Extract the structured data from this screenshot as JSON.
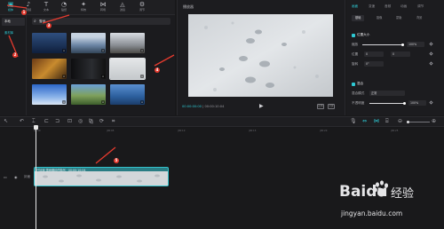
{
  "toolbar": {
    "items": [
      {
        "label": "媒体",
        "icon": "media-icon"
      },
      {
        "label": "音频",
        "icon": "audio-icon"
      },
      {
        "label": "文本",
        "icon": "text-icon"
      },
      {
        "label": "贴纸",
        "icon": "sticker-icon"
      },
      {
        "label": "特效",
        "icon": "effects-icon"
      },
      {
        "label": "转场",
        "icon": "transition-icon"
      },
      {
        "label": "滤镜",
        "icon": "filter-icon"
      },
      {
        "label": "调节",
        "icon": "adjust-icon"
      }
    ]
  },
  "categories": {
    "local": "本地",
    "library": "素材库"
  },
  "search": {
    "value": "雪地"
  },
  "media": {
    "thumbs": [
      {
        "dur": "",
        "style": "sky"
      },
      {
        "dur": "",
        "style": "cloud"
      },
      {
        "dur": "",
        "style": "mountain"
      },
      {
        "dur": "",
        "style": "sunset"
      },
      {
        "dur": "",
        "style": "dark"
      },
      {
        "dur": "",
        "style": "snow"
      },
      {
        "dur": "",
        "style": "blue"
      },
      {
        "dur": "",
        "style": "valley"
      },
      {
        "dur": "",
        "style": "ocean"
      }
    ]
  },
  "player": {
    "title": "播放器",
    "current_time": "00:00:00:00",
    "total_time": "00:00:10:04",
    "btn_ratio": "比例",
    "btn_full": "全屏"
  },
  "inspector": {
    "tabs": [
      "画面",
      "变速",
      "音频",
      "动画",
      "调节"
    ],
    "subtabs": [
      "基础",
      "抠像",
      "蒙版",
      "背景"
    ],
    "section_position": "位置大小",
    "scale_label": "缩放",
    "scale_value": "100%",
    "pos_label": "位置",
    "pos_x": "0",
    "pos_y": "0",
    "rotate_label": "旋转",
    "rotate_value": "0°",
    "section_blend": "混合",
    "blend_mode_label": "混合模式",
    "blend_mode_value": "正常",
    "opacity_label": "不透明度",
    "opacity_value": "100%"
  },
  "timeline": {
    "ticks": [
      "00:00",
      "|00:05",
      "|00:10",
      "|00:15",
      "|00:20",
      "|00:25"
    ],
    "track_label": "封面",
    "clip_label": "已加锁  雪地脚印的特写 · 00:00:10:04"
  },
  "annotations": [
    "1",
    "2",
    "3",
    "4",
    "5"
  ],
  "watermark": {
    "brand": "Baidu",
    "suffix": "经验",
    "url": "jingyan.baidu.com"
  },
  "colors": {
    "accent": "#2ec9d3",
    "annotation": "#e53a2e",
    "track": "#2a7d84"
  }
}
